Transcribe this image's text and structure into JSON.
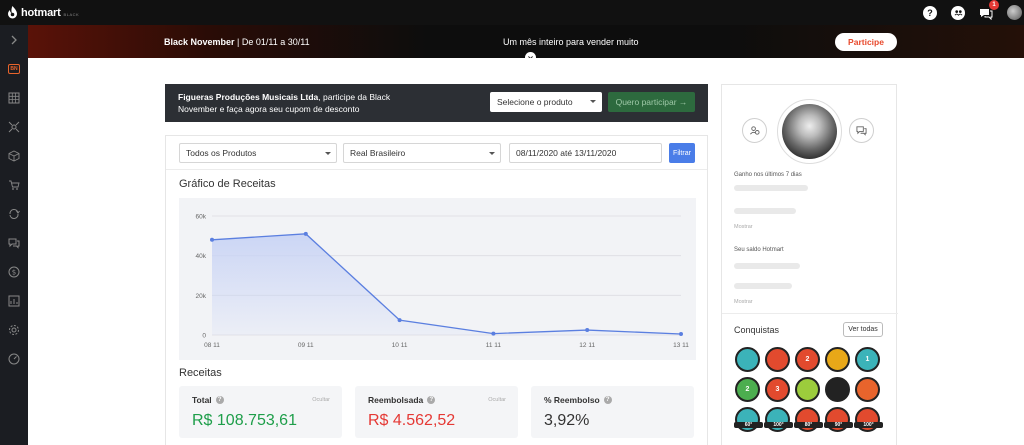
{
  "topbar": {
    "brand": "hotmart",
    "brand_sub": "BLACK",
    "notification_count": "1"
  },
  "banner": {
    "event_name": "Black November",
    "dates": " | De 01/11 a 30/11",
    "tagline": "Um mês inteiro para vender muito",
    "cta": "Participe"
  },
  "promo": {
    "company": "Figueras Produções Musicais Ltda",
    "message": ", participe da Black November e faça agora seu cupom de desconto",
    "select_placeholder": "Selecione o produto",
    "button": "Quero participar →"
  },
  "filters": {
    "product": "Todos os Produtos",
    "currency": "Real Brasileiro",
    "date_range": "08/11/2020 até 13/11/2020",
    "filter_button": "Filtrar"
  },
  "revenue_chart_title": "Gráfico de Receitas",
  "chart_data": {
    "type": "area",
    "categories": [
      "08 11",
      "09 11",
      "10 11",
      "11 11",
      "12 11",
      "13 11"
    ],
    "values": [
      48000,
      51000,
      7500,
      700,
      2500,
      500
    ],
    "y_ticks": [
      "0",
      "20k",
      "40k",
      "60k"
    ],
    "ylim": [
      0,
      60000
    ],
    "grid": true,
    "colors": {
      "line": "#5b7fe0",
      "fill": "#c9d4f5"
    }
  },
  "receitas": {
    "title": "Receitas",
    "hide_label": "Ocultar",
    "cards": [
      {
        "label": "Total",
        "value": "R$ 108.753,61",
        "color": "#1e9e4a"
      },
      {
        "label": "Reembolsada",
        "value": "R$ 4.562,52",
        "color": "#e53935"
      },
      {
        "label": "% Reembolso",
        "value": "3,92%",
        "color": "#333333"
      }
    ]
  },
  "profile": {
    "earned_label": "Ganho nos últimos 7 dias",
    "show_label": "Mostrar",
    "balance_label": "Seu saldo Hotmart",
    "achievements_title": "Conquistas",
    "see_all": "Ver todas",
    "badges": [
      {
        "text": "",
        "color": "#3bb3b9",
        "icon": "check-badge-icon"
      },
      {
        "text": "",
        "color": "#e24a2e",
        "icon": "crown-badge-icon"
      },
      {
        "text": "2",
        "color": "#e24a2e",
        "icon": "rank-2-badge-icon"
      },
      {
        "text": "",
        "color": "#e8a818",
        "icon": "trophy-badge-icon"
      },
      {
        "text": "1",
        "color": "#3bb3b9",
        "icon": "rank-1-badge-icon"
      },
      {
        "text": "2",
        "color": "#4cae4f",
        "icon": "rank-2-green-badge-icon"
      },
      {
        "text": "3",
        "color": "#e24a2e",
        "icon": "rank-3-badge-icon"
      },
      {
        "text": "",
        "color": "#9ccc3c",
        "icon": "glasses-badge-icon"
      },
      {
        "text": "",
        "color": "#222222",
        "icon": "ninja-badge-icon"
      },
      {
        "text": "",
        "color": "#e8642c",
        "icon": "fire-badge-icon"
      },
      {
        "text": "",
        "color": "#3bb3b9",
        "icon": "60-badge-icon",
        "ribbon": "60°"
      },
      {
        "text": "",
        "color": "#3bb3b9",
        "icon": "100-teal-badge-icon",
        "ribbon": "100°"
      },
      {
        "text": "",
        "color": "#e24a2e",
        "icon": "80-badge-icon",
        "ribbon": "80°"
      },
      {
        "text": "",
        "color": "#e24a2e",
        "icon": "90-badge-icon",
        "ribbon": "90°"
      },
      {
        "text": "",
        "color": "#e24a2e",
        "icon": "100-red-badge-icon",
        "ribbon": "100°"
      }
    ]
  }
}
